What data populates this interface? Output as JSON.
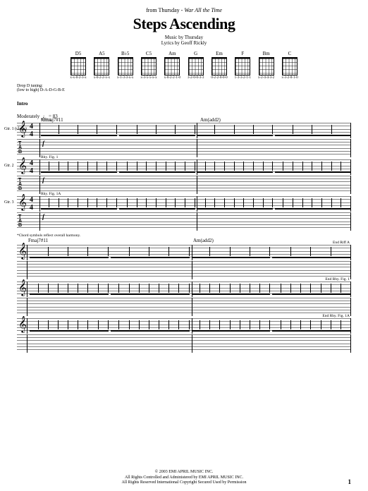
{
  "header": {
    "from_line_prefix": "from Thursday - ",
    "from_line_album": "War All the Time",
    "title": "Steps Ascending",
    "music_by": "Music by Thursday",
    "lyrics_by": "Lyrics by Geoff Rickly"
  },
  "chords": [
    {
      "name": "D5",
      "sub": "x-x-0-2-3-x"
    },
    {
      "name": "A5",
      "sub": "x-0-2-2-x-x"
    },
    {
      "name": "B♭5",
      "sub": "x-1-3-3-x-x"
    },
    {
      "name": "C5",
      "sub": "x-3-5-5-x-x"
    },
    {
      "name": "Am",
      "sub": "x-0-2-2-1-0"
    },
    {
      "name": "G",
      "sub": "3-2-0-0-3-3"
    },
    {
      "name": "Em",
      "sub": "0-2-2-0-0-0"
    },
    {
      "name": "F",
      "sub": "1-3-3-2-1-1"
    },
    {
      "name": "Bm",
      "sub": "x-2-4-4-3-2"
    },
    {
      "name": "C",
      "sub": "x-3-2-0-1-0"
    }
  ],
  "tuning": {
    "line1": "Drop D tuning:",
    "line2": "(low to high) D-A-D-G-B-E"
  },
  "intro": {
    "section": "Intro",
    "tempo_text": "Moderately",
    "tempo_mark": "♩ = 83",
    "chord1": "*Fmaj7#11",
    "chord2": "Am(add2)",
    "gtr1": "Gtr. 1 (clean)",
    "gtr2": "Gtr. 2",
    "gtr3": "Gtr. 3",
    "riff_a": "Riff A",
    "rhy1": "Rhy. Fig. 1",
    "rhy1a": "Rhy. Fig. 1A",
    "dyn": "f",
    "timesig_top": "4",
    "timesig_bot": "4"
  },
  "footnote": "*Chord symbols reflect overall harmony.",
  "system2": {
    "chord1": "Fmaj7#11",
    "chord2": "Am(add2)",
    "end_riff": "End Riff A",
    "end_rhy1": "End Rhy. Fig. 1",
    "end_rhy1a": "End Rhy. Fig. 1A"
  },
  "copyright": {
    "line1": "© 2003 EMI APRIL MUSIC INC.",
    "line2": "All Rights Controlled and Administered by EMI APRIL MUSIC INC.",
    "line3": "All Rights Reserved   International Copyright Secured   Used by Permission"
  },
  "page": "1"
}
